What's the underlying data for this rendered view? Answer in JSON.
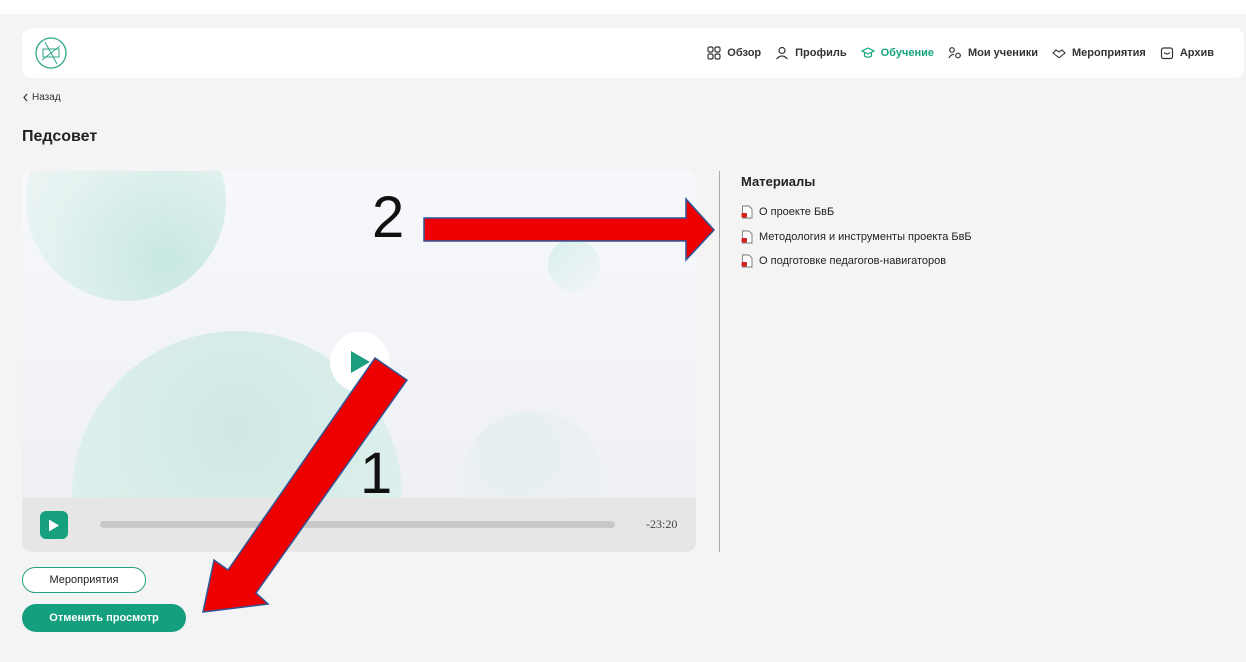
{
  "nav": {
    "items": [
      {
        "label": "Обзор",
        "icon": "grid-icon",
        "active": false
      },
      {
        "label": "Профиль",
        "icon": "user-icon",
        "active": false
      },
      {
        "label": "Обучение",
        "icon": "graduation-cap-icon",
        "active": true
      },
      {
        "label": "Мои ученики",
        "icon": "students-icon",
        "active": false
      },
      {
        "label": "Мероприятия",
        "icon": "handshake-icon",
        "active": false
      },
      {
        "label": "Архив",
        "icon": "archive-icon",
        "active": false
      }
    ]
  },
  "back_label": "Назад",
  "page_title": "Педсовет",
  "player": {
    "time_remaining": "-23:20"
  },
  "materials": {
    "title": "Материалы",
    "items": [
      "О проекте БвБ",
      "Методология и инструменты проекта БвБ",
      "О подготовке педагогов-навигаторов"
    ]
  },
  "buttons": {
    "events": "Мероприятия",
    "cancel_view": "Отменить просмотр"
  },
  "annotations": {
    "one": "1",
    "two": "2"
  },
  "colors": {
    "accent": "#14a37f",
    "arrow": "#ee0000"
  }
}
